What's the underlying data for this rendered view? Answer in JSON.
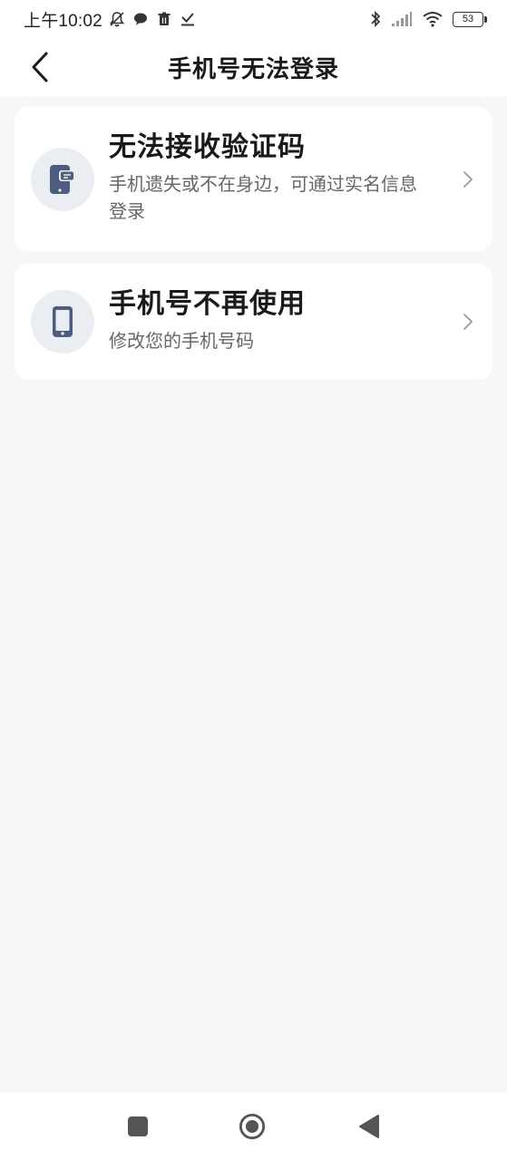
{
  "status_bar": {
    "time": "上午10:02",
    "battery": "53",
    "icons": [
      "mute-bell-icon",
      "chat-bubble-icon",
      "trash-icon",
      "download-check-icon",
      "bluetooth-icon",
      "signal-icon",
      "wifi-icon",
      "battery-icon"
    ]
  },
  "header": {
    "back_icon": "chevron-left-icon",
    "title": "手机号无法登录"
  },
  "options": [
    {
      "icon": "phone-message-icon",
      "title": "无法接收验证码",
      "description": "手机遗失或不在身边，可通过实名信息登录"
    },
    {
      "icon": "mobile-phone-icon",
      "title": "手机号不再使用",
      "description": "修改您的手机号码"
    }
  ],
  "system_nav": {
    "buttons": [
      "recents-square-icon",
      "home-circle-icon",
      "back-triangle-icon"
    ]
  },
  "colors": {
    "background": "#f7f7f7",
    "card": "#ffffff",
    "icon_circle": "#eaedf2",
    "icon_fill": "#4e5d7d",
    "title_text": "#1a1a1a",
    "secondary_text": "#666666"
  }
}
